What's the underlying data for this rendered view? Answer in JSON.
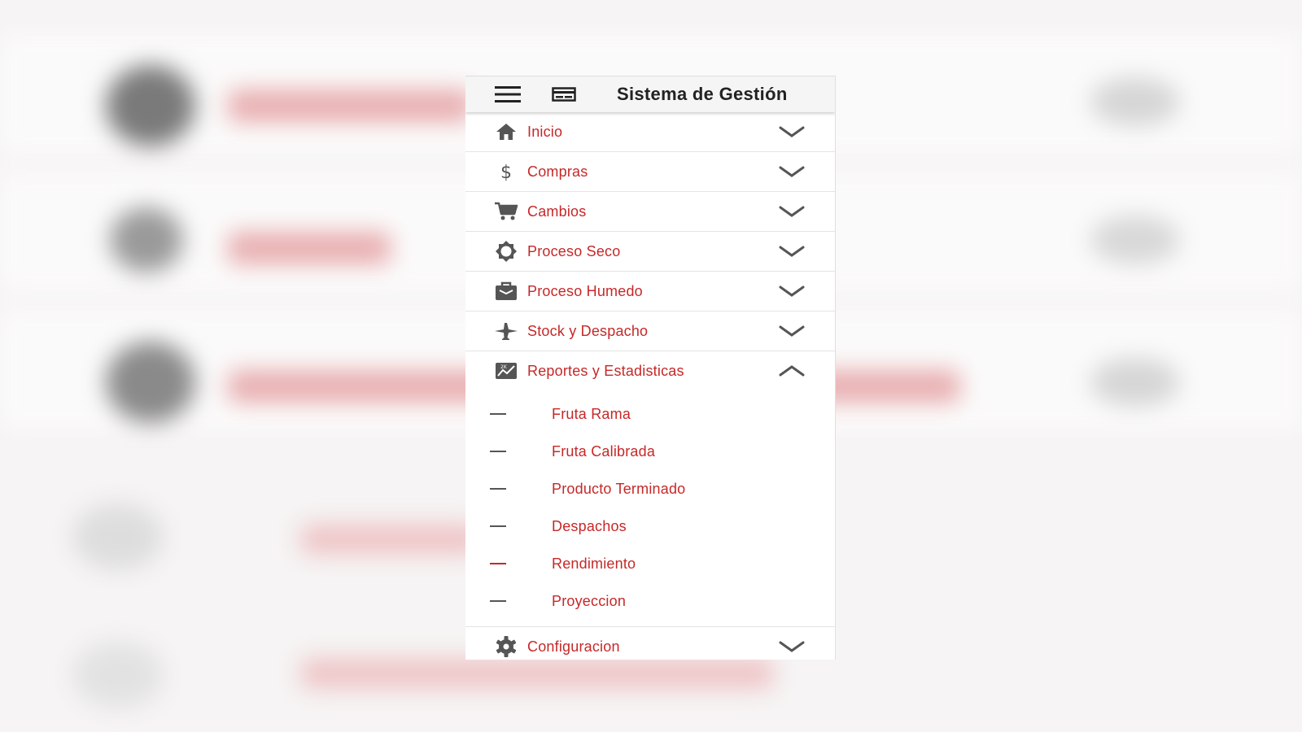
{
  "app": {
    "title": "Sistema de Gestión"
  },
  "colors": {
    "accent": "#c62828",
    "icon": "#555555"
  },
  "menu": [
    {
      "label": "Inicio",
      "icon": "home-icon"
    },
    {
      "label": "Compras",
      "icon": "dollar-icon"
    },
    {
      "label": "Cambios",
      "icon": "cart-icon"
    },
    {
      "label": "Proceso Seco",
      "icon": "brightness-icon"
    },
    {
      "label": "Proceso Humedo",
      "icon": "bag-icon"
    },
    {
      "label": "Stock y Despacho",
      "icon": "airplane-icon"
    },
    {
      "label": "Reportes y Estadisticas",
      "icon": "chart-icon",
      "expanded": true,
      "children": [
        {
          "label": "Fruta Rama"
        },
        {
          "label": "Fruta Calibrada"
        },
        {
          "label": "Producto Terminado"
        },
        {
          "label": "Despachos"
        },
        {
          "label": "Rendimiento",
          "active": true
        },
        {
          "label": "Proyeccion"
        }
      ]
    },
    {
      "label": "Configuracion",
      "icon": "gear-icon"
    }
  ]
}
